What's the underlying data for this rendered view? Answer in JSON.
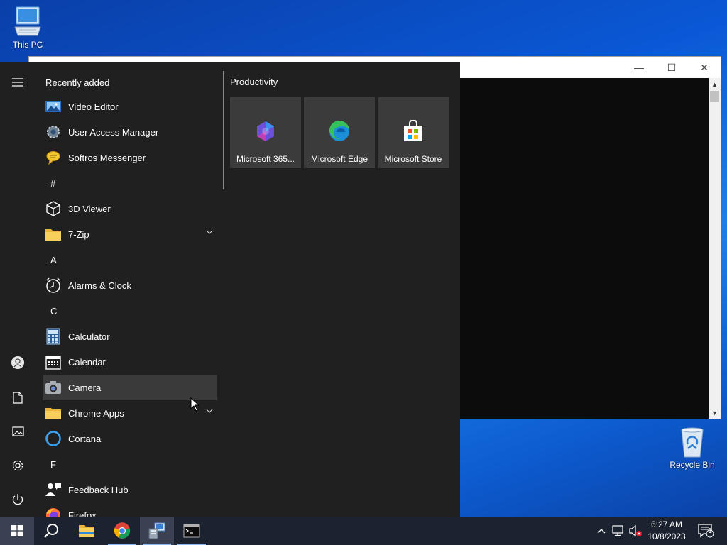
{
  "desktop": {
    "icons": [
      {
        "label": "This PC",
        "icon": "computer-icon"
      },
      {
        "label": "Recycle Bin",
        "icon": "recycle-bin-icon"
      }
    ]
  },
  "window": {
    "background": "#0c0c0c",
    "controls": {
      "minimize": "—",
      "maximize": "☐",
      "close": "✕"
    }
  },
  "start_menu": {
    "rail": [
      {
        "name": "menu",
        "icon": "hamburger-icon"
      },
      {
        "name": "account",
        "icon": "user-icon"
      },
      {
        "name": "documents",
        "icon": "document-icon"
      },
      {
        "name": "pictures",
        "icon": "pictures-icon"
      },
      {
        "name": "settings",
        "icon": "gear-icon"
      },
      {
        "name": "power",
        "icon": "power-icon"
      }
    ],
    "recently_added_header": "Recently added",
    "recent": [
      {
        "label": "Video Editor",
        "icon": "video-editor-icon"
      },
      {
        "label": "User Access Manager",
        "icon": "gear-icon"
      },
      {
        "label": "Softros Messenger",
        "icon": "messenger-icon"
      }
    ],
    "sections": [
      {
        "letter": "#",
        "items": [
          {
            "label": "3D Viewer",
            "icon": "cube-icon"
          },
          {
            "label": "7-Zip",
            "icon": "folder-icon",
            "expandable": true
          }
        ]
      },
      {
        "letter": "A",
        "items": [
          {
            "label": "Alarms & Clock",
            "icon": "clock-icon"
          }
        ]
      },
      {
        "letter": "C",
        "items": [
          {
            "label": "Calculator",
            "icon": "calculator-icon"
          },
          {
            "label": "Calendar",
            "icon": "calendar-icon"
          },
          {
            "label": "Camera",
            "icon": "camera-icon",
            "hover": true
          },
          {
            "label": "Chrome Apps",
            "icon": "folder-icon",
            "expandable": true
          },
          {
            "label": "Cortana",
            "icon": "cortana-icon"
          }
        ]
      },
      {
        "letter": "F",
        "items": [
          {
            "label": "Feedback Hub",
            "icon": "feedback-icon"
          },
          {
            "label": "Firefox",
            "icon": "firefox-icon"
          }
        ]
      }
    ],
    "tiles_group": "Productivity",
    "tiles": [
      {
        "label": "Microsoft 365...",
        "icon": "microsoft-365-icon"
      },
      {
        "label": "Microsoft Edge",
        "icon": "edge-icon"
      },
      {
        "label": "Microsoft Store",
        "icon": "store-icon"
      }
    ]
  },
  "taskbar": {
    "buttons": [
      {
        "name": "start",
        "icon": "windows-logo-icon"
      },
      {
        "name": "search",
        "icon": "search-icon"
      },
      {
        "name": "file-explorer",
        "icon": "folder-icon"
      },
      {
        "name": "chrome",
        "icon": "chrome-icon"
      },
      {
        "name": "network-app",
        "icon": "network-app-icon"
      },
      {
        "name": "terminal",
        "icon": "terminal-icon"
      }
    ],
    "tray": {
      "time": "6:27 AM",
      "date": "10/8/2023",
      "notification_count": "1"
    }
  },
  "colors": {
    "start_bg": "#202020",
    "tile_bg": "#3b3b3b",
    "hover_bg": "#3a3a3a",
    "taskbar_bg": "#1b2230",
    "desktop_blue": "#0a58d6"
  }
}
